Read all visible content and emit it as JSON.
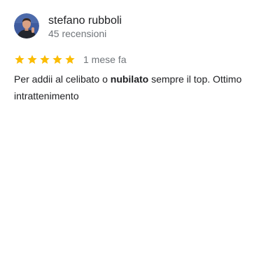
{
  "reviewer": {
    "name": "stefano rubboli",
    "review_count": "45 recensioni"
  },
  "rating": {
    "stars": 5,
    "max_stars": 5,
    "star_color": "#fbbc04"
  },
  "date": "1 mese fa",
  "review": {
    "text_before": "Per addii al celibato o ",
    "text_bold": "nubilato",
    "text_after": " sempre il top. Ottimo intrattenimento"
  },
  "colors": {
    "name": "#202124",
    "secondary": "#70757a",
    "avatar_bg": "#3d5a9e"
  }
}
